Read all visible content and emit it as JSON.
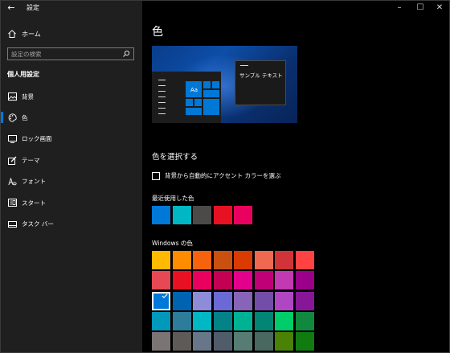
{
  "window": {
    "title": "設定",
    "back_icon": "back-arrow-icon",
    "controls": [
      "minimize-icon",
      "maximize-icon",
      "close-icon"
    ]
  },
  "sidebar": {
    "home": {
      "label": "ホーム",
      "icon": "home-icon"
    },
    "search": {
      "placeholder": "設定の検索",
      "icon": "search-icon"
    },
    "section_title": "個人用設定",
    "items": [
      {
        "label": "背景",
        "icon": "picture-icon",
        "active": false
      },
      {
        "label": "色",
        "icon": "palette-icon",
        "active": true
      },
      {
        "label": "ロック画面",
        "icon": "lock-screen-icon",
        "active": false
      },
      {
        "label": "テーマ",
        "icon": "theme-brush-icon",
        "active": false
      },
      {
        "label": "フォント",
        "icon": "font-icon",
        "active": false
      },
      {
        "label": "スタート",
        "icon": "start-icon",
        "active": false
      },
      {
        "label": "タスク バー",
        "icon": "taskbar-icon",
        "active": false
      }
    ]
  },
  "main": {
    "title": "色",
    "preview": {
      "sample_text": "サンプル テキスト",
      "tile_text": "Aa"
    },
    "choose_heading": "色を選択する",
    "auto_accent_checkbox": {
      "label": "背景から自動的にアクセント カラーを選ぶ",
      "checked": false
    },
    "recent_label": "最近使用した色",
    "recent_colors": [
      "#0078d7",
      "#00b7c3",
      "#4c4a48",
      "#e81123",
      "#ea005e"
    ],
    "windows_colors_label": "Windows の色",
    "windows_colors": [
      [
        "#ffb900",
        "#ff8c00",
        "#f7630c",
        "#ca5010",
        "#da3b01",
        "#ef6950",
        "#d13438",
        "#ff4343"
      ],
      [
        "#e74856",
        "#e81123",
        "#ea005e",
        "#c30052",
        "#e3008c",
        "#bf0077",
        "#c239b3",
        "#9a0089"
      ],
      [
        "#0078d7",
        "#0063b1",
        "#8e8cd8",
        "#6b69d6",
        "#8764b8",
        "#744da9",
        "#b146c2",
        "#881798"
      ],
      [
        "#0099bc",
        "#2d7d9a",
        "#00b7c3",
        "#038387",
        "#00b294",
        "#018574",
        "#00cc6a",
        "#10893e"
      ],
      [
        "#7a7574",
        "#5d5a58",
        "#68768a",
        "#515c6b",
        "#567c73",
        "#486860",
        "#498205",
        "#107c10"
      ]
    ],
    "selected_color": "#0078d7",
    "accent_color": "#0078d7"
  }
}
